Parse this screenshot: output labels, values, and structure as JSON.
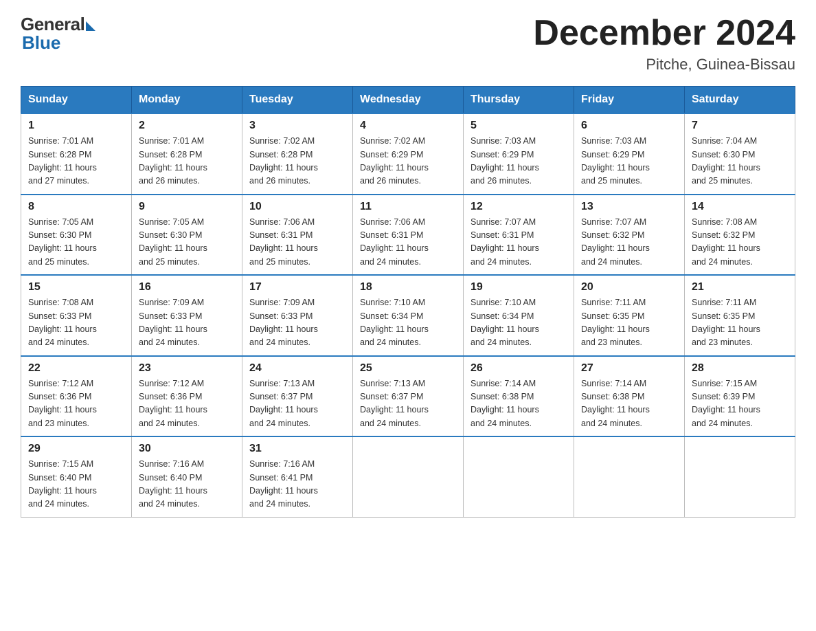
{
  "logo": {
    "general": "General",
    "blue": "Blue"
  },
  "title": "December 2024",
  "subtitle": "Pitche, Guinea-Bissau",
  "weekdays": [
    "Sunday",
    "Monday",
    "Tuesday",
    "Wednesday",
    "Thursday",
    "Friday",
    "Saturday"
  ],
  "weeks": [
    [
      {
        "day": "1",
        "sunrise": "7:01 AM",
        "sunset": "6:28 PM",
        "daylight": "11 hours and 27 minutes."
      },
      {
        "day": "2",
        "sunrise": "7:01 AM",
        "sunset": "6:28 PM",
        "daylight": "11 hours and 26 minutes."
      },
      {
        "day": "3",
        "sunrise": "7:02 AM",
        "sunset": "6:28 PM",
        "daylight": "11 hours and 26 minutes."
      },
      {
        "day": "4",
        "sunrise": "7:02 AM",
        "sunset": "6:29 PM",
        "daylight": "11 hours and 26 minutes."
      },
      {
        "day": "5",
        "sunrise": "7:03 AM",
        "sunset": "6:29 PM",
        "daylight": "11 hours and 26 minutes."
      },
      {
        "day": "6",
        "sunrise": "7:03 AM",
        "sunset": "6:29 PM",
        "daylight": "11 hours and 25 minutes."
      },
      {
        "day": "7",
        "sunrise": "7:04 AM",
        "sunset": "6:30 PM",
        "daylight": "11 hours and 25 minutes."
      }
    ],
    [
      {
        "day": "8",
        "sunrise": "7:05 AM",
        "sunset": "6:30 PM",
        "daylight": "11 hours and 25 minutes."
      },
      {
        "day": "9",
        "sunrise": "7:05 AM",
        "sunset": "6:30 PM",
        "daylight": "11 hours and 25 minutes."
      },
      {
        "day": "10",
        "sunrise": "7:06 AM",
        "sunset": "6:31 PM",
        "daylight": "11 hours and 25 minutes."
      },
      {
        "day": "11",
        "sunrise": "7:06 AM",
        "sunset": "6:31 PM",
        "daylight": "11 hours and 24 minutes."
      },
      {
        "day": "12",
        "sunrise": "7:07 AM",
        "sunset": "6:31 PM",
        "daylight": "11 hours and 24 minutes."
      },
      {
        "day": "13",
        "sunrise": "7:07 AM",
        "sunset": "6:32 PM",
        "daylight": "11 hours and 24 minutes."
      },
      {
        "day": "14",
        "sunrise": "7:08 AM",
        "sunset": "6:32 PM",
        "daylight": "11 hours and 24 minutes."
      }
    ],
    [
      {
        "day": "15",
        "sunrise": "7:08 AM",
        "sunset": "6:33 PM",
        "daylight": "11 hours and 24 minutes."
      },
      {
        "day": "16",
        "sunrise": "7:09 AM",
        "sunset": "6:33 PM",
        "daylight": "11 hours and 24 minutes."
      },
      {
        "day": "17",
        "sunrise": "7:09 AM",
        "sunset": "6:33 PM",
        "daylight": "11 hours and 24 minutes."
      },
      {
        "day": "18",
        "sunrise": "7:10 AM",
        "sunset": "6:34 PM",
        "daylight": "11 hours and 24 minutes."
      },
      {
        "day": "19",
        "sunrise": "7:10 AM",
        "sunset": "6:34 PM",
        "daylight": "11 hours and 24 minutes."
      },
      {
        "day": "20",
        "sunrise": "7:11 AM",
        "sunset": "6:35 PM",
        "daylight": "11 hours and 23 minutes."
      },
      {
        "day": "21",
        "sunrise": "7:11 AM",
        "sunset": "6:35 PM",
        "daylight": "11 hours and 23 minutes."
      }
    ],
    [
      {
        "day": "22",
        "sunrise": "7:12 AM",
        "sunset": "6:36 PM",
        "daylight": "11 hours and 23 minutes."
      },
      {
        "day": "23",
        "sunrise": "7:12 AM",
        "sunset": "6:36 PM",
        "daylight": "11 hours and 24 minutes."
      },
      {
        "day": "24",
        "sunrise": "7:13 AM",
        "sunset": "6:37 PM",
        "daylight": "11 hours and 24 minutes."
      },
      {
        "day": "25",
        "sunrise": "7:13 AM",
        "sunset": "6:37 PM",
        "daylight": "11 hours and 24 minutes."
      },
      {
        "day": "26",
        "sunrise": "7:14 AM",
        "sunset": "6:38 PM",
        "daylight": "11 hours and 24 minutes."
      },
      {
        "day": "27",
        "sunrise": "7:14 AM",
        "sunset": "6:38 PM",
        "daylight": "11 hours and 24 minutes."
      },
      {
        "day": "28",
        "sunrise": "7:15 AM",
        "sunset": "6:39 PM",
        "daylight": "11 hours and 24 minutes."
      }
    ],
    [
      {
        "day": "29",
        "sunrise": "7:15 AM",
        "sunset": "6:40 PM",
        "daylight": "11 hours and 24 minutes."
      },
      {
        "day": "30",
        "sunrise": "7:16 AM",
        "sunset": "6:40 PM",
        "daylight": "11 hours and 24 minutes."
      },
      {
        "day": "31",
        "sunrise": "7:16 AM",
        "sunset": "6:41 PM",
        "daylight": "11 hours and 24 minutes."
      },
      null,
      null,
      null,
      null
    ]
  ],
  "labels": {
    "sunrise": "Sunrise:",
    "sunset": "Sunset:",
    "daylight": "Daylight:"
  }
}
